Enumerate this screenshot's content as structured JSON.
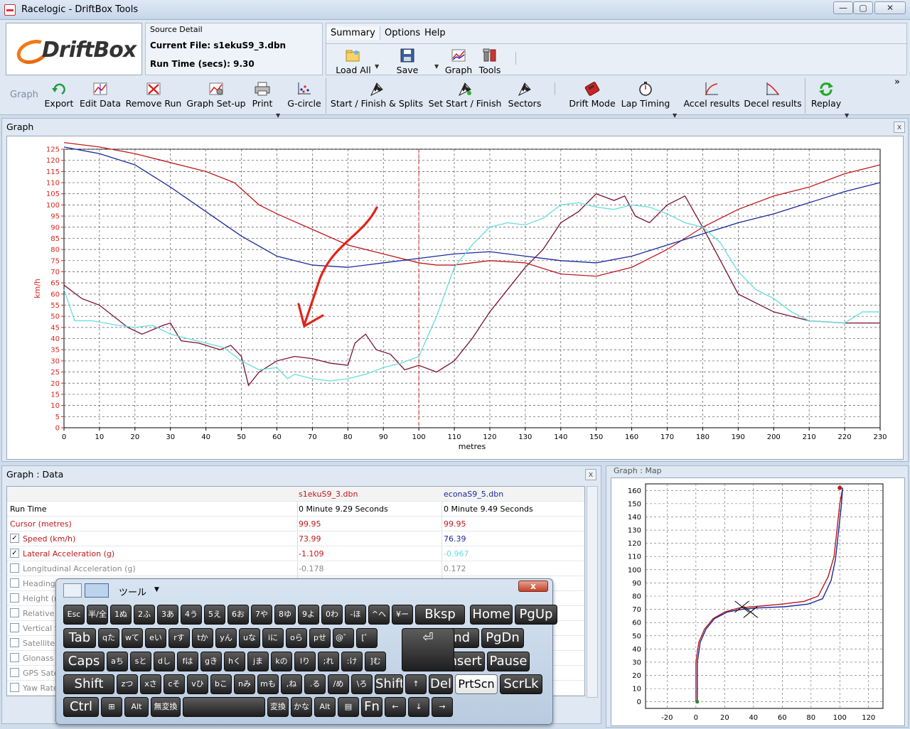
{
  "window": {
    "title": "Racelogic - DriftBox Tools",
    "min_glyph": "—",
    "max_glyph": "▢",
    "close_glyph": "✕"
  },
  "logo": {
    "text": "DriftBox"
  },
  "source": {
    "caption": "Source Detail",
    "current_file": "Current File: s1ekuS9_3.dbn",
    "run_time": "Run Time (secs): 9.30"
  },
  "menu": {
    "summary": "Summary",
    "options": "Options",
    "help": "Help"
  },
  "menu_tools": {
    "load_all": "Load All",
    "save": "Save",
    "graph": "Graph",
    "tools": "Tools"
  },
  "toolbar": {
    "group_label": "Graph",
    "export": "Export",
    "edit_data": "Edit Data",
    "remove_run": "Remove Run",
    "graph_setup": "Graph Set-up",
    "print": "Print",
    "g_circle": "G-circle",
    "start_finish": "Start / Finish & Splits",
    "set_start_finish": "Set Start / Finish",
    "sectors": "Sectors",
    "drift_mode": "Drift Mode",
    "lap_timing": "Lap Timing",
    "accel": "Accel results",
    "decel": "Decel results",
    "replay": "Replay",
    "overflow": "»"
  },
  "graph_panel": {
    "title": "Graph",
    "close": "x"
  },
  "data_panel": {
    "title": "Graph : Data",
    "close": "x",
    "columns": [
      "",
      "s1ekuS9_3.dbn",
      "econaS9_5.dbn"
    ],
    "rows": [
      {
        "check": "",
        "label": "Run Time",
        "v1": "0 Minute 9.29 Seconds",
        "v2": "0 Minute 9.49 Seconds"
      },
      {
        "check": "",
        "label": "Cursor (metres)",
        "v1": "99.95",
        "v2": "99.95"
      },
      {
        "check": "✓",
        "label": "Speed (km/h)",
        "v1": "73.99",
        "v2": "76.39"
      },
      {
        "check": "✓",
        "label": "Lateral Acceleration (g)",
        "v1": "-1.109",
        "v2": "-0.967"
      },
      {
        "check": "",
        "label": "Longitudinal Acceleration (g)",
        "v1": "-0.178",
        "v2": "0.172"
      },
      {
        "check": "",
        "label": "Heading",
        "v1": "",
        "v2": ""
      },
      {
        "check": "",
        "label": "Height (m",
        "v1": "",
        "v2": ""
      },
      {
        "check": "",
        "label": "Relative H",
        "v1": "",
        "v2": ""
      },
      {
        "check": "",
        "label": "Vertical S",
        "v1": "",
        "v2": ""
      },
      {
        "check": "",
        "label": "Satellites",
        "v1": "",
        "v2": ""
      },
      {
        "check": "",
        "label": "Glonass S",
        "v1": "",
        "v2": ""
      },
      {
        "check": "",
        "label": "GPS Sate",
        "v1": "",
        "v2": ""
      },
      {
        "check": "",
        "label": "Yaw Rate",
        "v1": "",
        "v2": ""
      }
    ]
  },
  "map_panel": {
    "title": "Graph : Map"
  },
  "osk": {
    "tools": "ツール",
    "close": "x",
    "rows": [
      [
        "Esc",
        "半/全",
        "1ぬ",
        "2ふ",
        "3あ",
        "4う",
        "5え",
        "6お",
        "7や",
        "8ゆ",
        "9よ",
        "0わ",
        "-ほ",
        "^へ",
        "¥ー",
        "Bksp",
        "Home",
        "PgUp"
      ],
      [
        "Tab",
        "qた",
        "wて",
        "eい",
        "rす",
        "tか",
        "yん",
        "uな",
        "iに",
        "oら",
        "pせ",
        "@゛",
        "[゜",
        "End",
        "PgDn"
      ],
      [
        "Caps",
        "aち",
        "sと",
        "dし",
        "fは",
        "gき",
        "hく",
        "jま",
        "kの",
        "lり",
        ";れ",
        ":け",
        "]む",
        "Insert",
        "Pause"
      ],
      [
        "Shift",
        "zつ",
        "xさ",
        "cそ",
        "vひ",
        "bこ",
        "nみ",
        "mも",
        ",ね",
        ".る",
        "/め",
        "\\ろ",
        "Shift",
        "↑",
        "Del",
        "PrtScn",
        "ScrLk"
      ],
      [
        "Ctrl",
        "⊞",
        "Alt",
        "無変換",
        "",
        "変換",
        "かな",
        "Alt",
        "▤",
        "Fn",
        "←",
        "↓",
        "→"
      ]
    ]
  },
  "colors": {
    "run1": "#c0181c",
    "run2": "#1a2a9a",
    "run3": "#7a1030",
    "run4": "#66dddd",
    "accent": "#d8261c"
  },
  "chart_data": [
    {
      "type": "line",
      "xlabel": "metres",
      "ylabel": "km/h",
      "xlim": [
        0,
        230
      ],
      "ylim": [
        0,
        125
      ],
      "xticks": [
        0,
        10,
        20,
        30,
        40,
        50,
        60,
        70,
        80,
        90,
        100,
        110,
        120,
        130,
        140,
        150,
        160,
        170,
        180,
        190,
        200,
        210,
        220,
        230
      ],
      "yticks": [
        0,
        5,
        10,
        15,
        20,
        25,
        30,
        35,
        40,
        45,
        50,
        55,
        60,
        65,
        70,
        75,
        80,
        85,
        90,
        95,
        100,
        105,
        110,
        115,
        120,
        125
      ],
      "cursor_x": 100,
      "grid": true,
      "series": [
        {
          "color_key": "run1",
          "x": [
            0,
            10,
            20,
            30,
            40,
            48,
            55,
            60,
            70,
            80,
            90,
            100,
            105,
            110,
            120,
            130,
            140,
            150,
            160,
            170,
            180,
            190,
            200,
            210,
            220,
            230
          ],
          "y": [
            128,
            126,
            123,
            119,
            115,
            110,
            100,
            96,
            89,
            82,
            78,
            74,
            73,
            73,
            75,
            74,
            69,
            68,
            72,
            80,
            90,
            98,
            104,
            108,
            114,
            118
          ]
        },
        {
          "color_key": "run2",
          "x": [
            0,
            10,
            20,
            30,
            40,
            50,
            60,
            70,
            80,
            90,
            100,
            110,
            120,
            130,
            140,
            150,
            160,
            170,
            180,
            190,
            200,
            210,
            220,
            230
          ],
          "y": [
            126,
            123,
            118,
            108,
            97,
            86,
            77,
            73,
            72,
            74,
            76,
            78,
            79,
            77,
            75,
            74,
            77,
            82,
            87,
            92,
            96,
            101,
            106,
            110
          ]
        },
        {
          "color_key": "run3",
          "x": [
            0,
            5,
            10,
            18,
            22,
            28,
            30,
            33,
            38,
            44,
            47,
            50,
            52,
            55,
            60,
            65,
            70,
            75,
            80,
            82,
            85,
            88,
            92,
            96,
            100,
            105,
            110,
            115,
            120,
            125,
            130,
            135,
            140,
            145,
            150,
            155,
            158,
            161,
            165,
            170,
            175,
            180,
            185,
            190,
            200,
            210,
            220,
            230
          ],
          "y": [
            64,
            58,
            55,
            45,
            42,
            46,
            47,
            39,
            38,
            35,
            37,
            32,
            19,
            25,
            30,
            32,
            31,
            29,
            28,
            38,
            42,
            35,
            33,
            26,
            28,
            25,
            30,
            40,
            52,
            62,
            72,
            80,
            92,
            97,
            105,
            102,
            104,
            95,
            92,
            100,
            104,
            90,
            75,
            60,
            52,
            48,
            47,
            47
          ]
        },
        {
          "color_key": "run4",
          "x": [
            0,
            3,
            8,
            15,
            20,
            25,
            30,
            35,
            40,
            45,
            50,
            55,
            60,
            63,
            65,
            70,
            75,
            80,
            85,
            90,
            95,
            100,
            105,
            110,
            115,
            120,
            125,
            130,
            135,
            140,
            145,
            150,
            155,
            160,
            165,
            170,
            175,
            180,
            185,
            190,
            195,
            200,
            205,
            210,
            220,
            225,
            230
          ],
          "y": [
            62,
            48,
            48,
            46,
            45,
            46,
            42,
            40,
            38,
            36,
            30,
            26,
            27,
            22,
            24,
            22,
            21,
            22,
            24,
            27,
            29,
            32,
            50,
            72,
            82,
            90,
            92,
            91,
            94,
            100,
            101,
            99,
            98,
            100,
            99,
            96,
            92,
            90,
            83,
            70,
            62,
            58,
            52,
            48,
            47,
            52,
            52
          ]
        }
      ]
    },
    {
      "type": "line",
      "xlim": [
        -35,
        130
      ],
      "ylim": [
        -5,
        165
      ],
      "xticks": [
        -20,
        0,
        20,
        40,
        60,
        80,
        100,
        120
      ],
      "yticks": [
        0,
        10,
        20,
        30,
        40,
        50,
        60,
        70,
        80,
        90,
        100,
        110,
        120,
        130,
        140,
        150,
        160
      ],
      "grid": true,
      "series": [
        {
          "color_key": "run1",
          "x": [
            0,
            0,
            0,
            2,
            6,
            12,
            20,
            30,
            40,
            60,
            75,
            85,
            92,
            96,
            98,
            100,
            102
          ],
          "y": [
            0,
            10,
            30,
            45,
            55,
            63,
            68,
            71,
            72,
            74,
            76,
            80,
            95,
            110,
            130,
            150,
            162
          ]
        },
        {
          "color_key": "run2",
          "x": [
            1,
            1,
            1,
            3,
            7,
            13,
            22,
            32,
            42,
            62,
            78,
            88,
            94,
            97,
            99,
            101,
            102
          ],
          "y": [
            0,
            10,
            30,
            45,
            55,
            63,
            68,
            70,
            71,
            72,
            74,
            78,
            92,
            108,
            128,
            148,
            162
          ]
        }
      ]
    }
  ]
}
